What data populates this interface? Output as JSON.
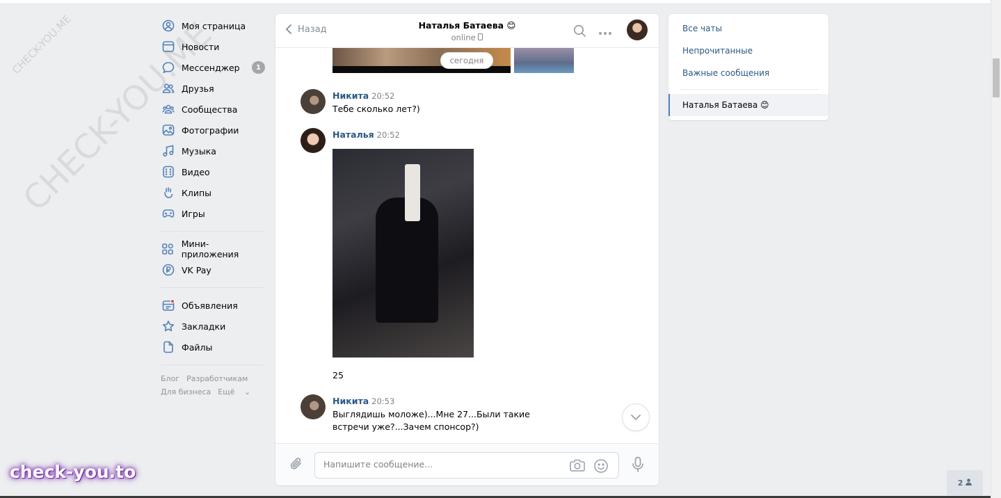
{
  "sidebar": {
    "items": [
      {
        "label": "Моя страница",
        "icon": "user-circle-icon"
      },
      {
        "label": "Новости",
        "icon": "news-icon"
      },
      {
        "label": "Мессенджер",
        "icon": "chat-bubble-icon",
        "badge": "1"
      },
      {
        "label": "Друзья",
        "icon": "friends-icon"
      },
      {
        "label": "Сообщества",
        "icon": "communities-icon"
      },
      {
        "label": "Фотографии",
        "icon": "photo-icon"
      },
      {
        "label": "Музыка",
        "icon": "music-note-icon"
      },
      {
        "label": "Видео",
        "icon": "video-icon"
      },
      {
        "label": "Клипы",
        "icon": "clips-icon"
      },
      {
        "label": "Игры",
        "icon": "gamepad-icon"
      }
    ],
    "items2": [
      {
        "label": "Мини-приложения",
        "icon": "apps-grid-icon"
      },
      {
        "label": "VK Pay",
        "icon": "vkpay-icon"
      }
    ],
    "items3": [
      {
        "label": "Объявления",
        "icon": "ads-icon"
      },
      {
        "label": "Закладки",
        "icon": "star-icon"
      },
      {
        "label": "Файлы",
        "icon": "file-icon"
      }
    ],
    "footer": {
      "blog": "Блог",
      "developers": "Разработчикам",
      "business": "Для бизнеса",
      "more": "Ещё"
    }
  },
  "chat": {
    "back_label": "Назад",
    "peer_name": "Наталья Батаева 😊",
    "peer_status": "online",
    "date_divider": "сегодня",
    "messages": [
      {
        "author": "Никита",
        "time": "20:52",
        "text": "Тебе сколько лет?)"
      },
      {
        "author": "Наталья",
        "time": "20:52",
        "text": "25"
      },
      {
        "author": "Никита",
        "time": "20:53",
        "text": "Выглядишь моложе)...Мне 27...Были такие встречи уже?...Зачем спонсор?)"
      }
    ],
    "composer_placeholder": "Напишите сообщение..."
  },
  "right_panel": {
    "all_chats": "Все чаты",
    "unread": "Непрочитанные",
    "important": "Важные сообщения",
    "active_chat": "Наталья Батаева 😊"
  },
  "watermark": {
    "diag": "CHECK-YOU.ME",
    "small": "CHECK-YOU.ME",
    "brand": "check-you.to"
  },
  "online_counter": "2",
  "colors": {
    "accent": "#2a5885",
    "background": "#edeef0",
    "badge": "#a3a6aa",
    "brand_glow": "#7a2ab0"
  }
}
